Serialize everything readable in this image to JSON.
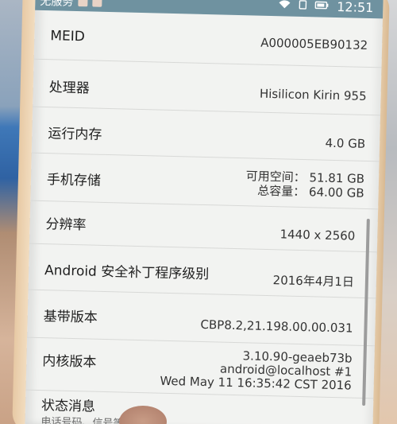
{
  "status_bar": {
    "carrier": "无服务",
    "time": "12:51",
    "icons": [
      "notification-icon",
      "wifi-icon",
      "sim-icon",
      "battery-icon"
    ]
  },
  "rows": [
    {
      "label": "MEID",
      "value_lines": [
        "A000005EB90132"
      ]
    },
    {
      "label": "处理器",
      "value_lines": [
        "Hisilicon Kirin 955"
      ]
    },
    {
      "label": "运行内存",
      "value_lines": [
        "4.0 GB"
      ]
    },
    {
      "label": "手机存储",
      "value_lines": [
        "可用空间： 51.81  GB",
        "总容量： 64.00  GB"
      ]
    },
    {
      "label": "分辨率",
      "value_lines": [
        "1440 x 2560"
      ]
    },
    {
      "label": "Android 安全补丁程序级别",
      "value_lines": [
        "2016年4月1日"
      ]
    },
    {
      "label": "基带版本",
      "value_lines": [
        "CBP8.2,21.198.00.00.031"
      ]
    },
    {
      "label": "内核版本",
      "value_lines": [
        "3.10.90-geaeb73b",
        "android@localhost #1",
        "Wed May 11 16:35:42 CST 2016"
      ]
    },
    {
      "label": "状态消息",
      "value_lines": []
    }
  ],
  "partial_text": "电话号码、信号等"
}
